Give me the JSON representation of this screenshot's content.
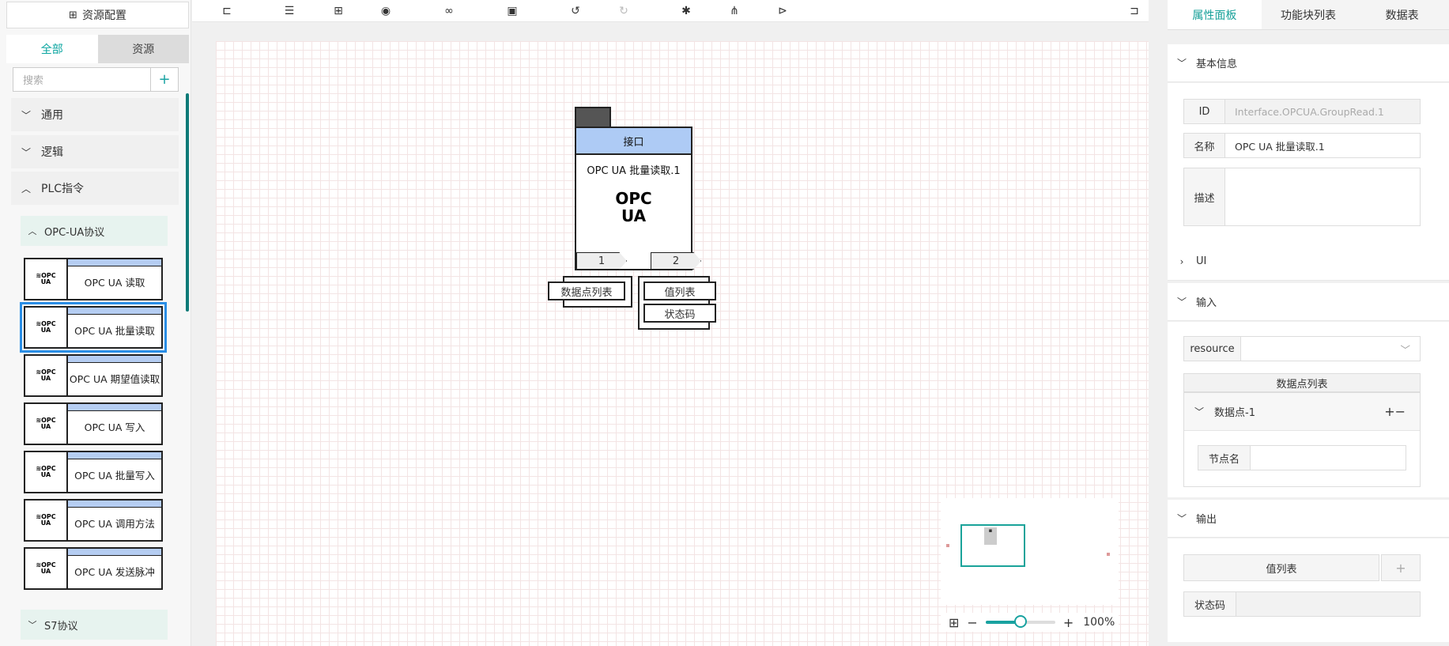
{
  "left_panel": {
    "resource_config_label": "资源配置",
    "tabs": [
      "全部",
      "资源"
    ],
    "search_placeholder": "搜索",
    "add_symbol": "+",
    "categories": [
      "通用",
      "逻辑",
      "PLC指令"
    ],
    "subcategories": [
      "OPC-UA协议",
      "S7协议"
    ],
    "blocks": [
      {
        "label": "OPC UA 读取",
        "logo": "OPC UA"
      },
      {
        "label": "OPC UA 批量读取",
        "logo": "OPC UA"
      },
      {
        "label": "OPC UA 期望值读取",
        "logo": "OPC UA"
      },
      {
        "label": "OPC UA 写入",
        "logo": "OPC UA"
      },
      {
        "label": "OPC UA 批量写入",
        "logo": "OPC UA"
      },
      {
        "label": "OPC UA 调用方法",
        "logo": "OPC UA"
      },
      {
        "label": "OPC UA 发送脉冲",
        "logo": "OPC UA"
      }
    ]
  },
  "toolbar": {
    "icons": [
      "collapse-left-icon",
      "align-icon",
      "fit-icon",
      "preview-icon",
      "link-icon",
      "save-icon",
      "undo-icon",
      "redo-icon",
      "debug-icon",
      "network-icon",
      "run-icon",
      "expand-right-icon"
    ]
  },
  "canvas": {
    "node": {
      "header": "接口",
      "name": "OPC UA 批量读取.1",
      "logo_line1": "OPC",
      "logo_line2": "UA",
      "port1": "1",
      "port2": "2",
      "input_pin": "数据点列表",
      "output_pins": [
        "值列表",
        "状态码"
      ]
    },
    "zoom_label": "100%",
    "zoom_level": 0.5
  },
  "right_panel": {
    "tabs": [
      "属性面板",
      "功能块列表",
      "数据表"
    ],
    "basic_info": {
      "title": "基本信息",
      "id_label": "ID",
      "id_value": "Interface.OPCUA.GroupRead.1",
      "name_label": "名称",
      "name_value": "OPC UA 批量读取.1",
      "desc_label": "描述"
    },
    "ui_section": "UI",
    "input_section": {
      "title": "输入",
      "resource_label": "resource",
      "list_title": "数据点列表",
      "point_title": "数据点-1",
      "plus_minus": "+−",
      "node_name_label": "节点名"
    },
    "output_section": {
      "title": "输出",
      "value_list_label": "值列表",
      "add_symbol": "+",
      "status_label": "状态码"
    }
  }
}
